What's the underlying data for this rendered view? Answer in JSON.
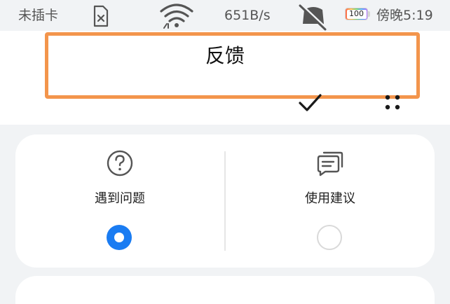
{
  "status_bar": {
    "carrier": "未插卡",
    "speed": "651B/s",
    "battery": "100",
    "time": "傍晚5:19",
    "icons": [
      "sim-card-icon",
      "wifi-icon",
      "mute-icon",
      "battery-icon"
    ]
  },
  "header": {
    "title": "反馈",
    "actions": [
      "check-icon",
      "more-icon"
    ],
    "highlight_color": "#f3954c"
  },
  "feedback_options": [
    {
      "label": "遇到问题",
      "icon": "question-circle-icon",
      "selected": true
    },
    {
      "label": "使用建议",
      "icon": "chat-bubbles-icon",
      "selected": false
    }
  ],
  "colors": {
    "accent": "#1a7cf2",
    "background": "#f1f3f5",
    "card": "#ffffff"
  }
}
